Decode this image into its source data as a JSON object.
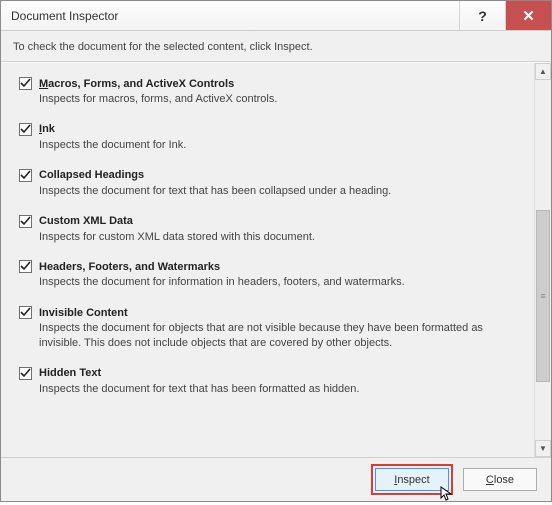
{
  "title": "Document Inspector",
  "instruction": "To check the document for the selected content, click Inspect.",
  "items": [
    {
      "title_pre": "M",
      "title_rest": "acros, Forms, and ActiveX Controls",
      "desc": "Inspects for macros, forms, and ActiveX controls."
    },
    {
      "title_pre": "I",
      "title_rest": "nk",
      "desc": "Inspects the document for Ink."
    },
    {
      "title_pre": "",
      "title_rest": "Collapsed Headings",
      "desc": "Inspects the document for text that has been collapsed under a heading."
    },
    {
      "title_pre": "",
      "title_rest": "Custom XML Data",
      "desc": "Inspects for custom XML data stored with this document."
    },
    {
      "title_pre": "",
      "title_rest": "Headers, Footers, and Watermarks",
      "desc": "Inspects the document for information in headers, footers, and watermarks."
    },
    {
      "title_pre": "",
      "title_rest": "Invisible Content",
      "desc": "Inspects the document for objects that are not visible because they have been formatted as invisible. This does not include objects that are covered by other objects."
    },
    {
      "title_pre": "",
      "title_rest": "Hidden Text",
      "desc": "Inspects the document for text that has been formatted as hidden."
    }
  ],
  "buttons": {
    "inspect_pre": "I",
    "inspect_rest": "nspect",
    "close_pre": "C",
    "close_rest": "lose"
  },
  "help_glyph": "?",
  "close_glyph": "✕",
  "scroll_up": "▲",
  "scroll_down": "▼"
}
